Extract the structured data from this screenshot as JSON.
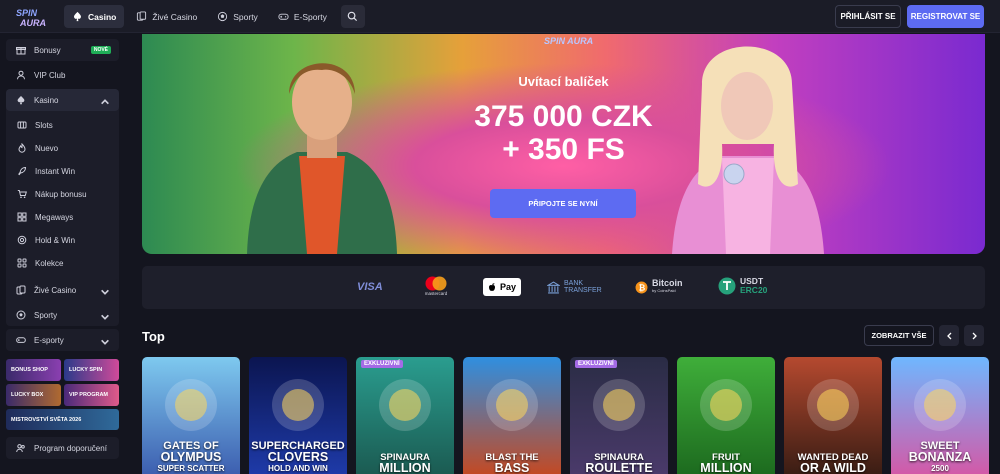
{
  "header": {
    "logo_text": "SPIN AURA",
    "nav": [
      {
        "label": "Casino",
        "icon": "spade-icon",
        "active": true
      },
      {
        "label": "Živé Casino",
        "icon": "cards-icon"
      },
      {
        "label": "Sporty",
        "icon": "ball-icon"
      },
      {
        "label": "E-Sporty",
        "icon": "gamepad-icon"
      }
    ],
    "login_label": "PŘIHLÁSIT SE",
    "register_label": "REGISTROVAT SE"
  },
  "sidebar": {
    "bonusy": {
      "label": "Bonusy",
      "badge": "NOVÉ"
    },
    "vip": {
      "label": "VIP Club"
    },
    "kasino": {
      "label": "Kasino"
    },
    "kasino_items": [
      {
        "label": "Slots",
        "icon": "slot-icon"
      },
      {
        "label": "Nuevo",
        "icon": "fire-icon"
      },
      {
        "label": "Instant Win",
        "icon": "rocket-icon"
      },
      {
        "label": "Nákup bonusu",
        "icon": "cart-icon"
      },
      {
        "label": "Megaways",
        "icon": "grid-icon"
      },
      {
        "label": "Hold & Win",
        "icon": "coin-icon"
      },
      {
        "label": "Kolekce",
        "icon": "collection-icon"
      }
    ],
    "live": {
      "label": "Živé Casino"
    },
    "sport": {
      "label": "Sporty"
    },
    "esport": {
      "label": "E-sporty"
    },
    "promos": [
      {
        "label": "BONUS SHOP"
      },
      {
        "label": "LUCKY SPIN"
      },
      {
        "label": "LUCKY BOX"
      },
      {
        "label": "VIP PROGRAM"
      },
      {
        "label": "MISTROVSTVÍ SVĚTA 2026"
      }
    ],
    "referral": {
      "label": "Program doporučení"
    }
  },
  "hero": {
    "logo_text": "SPIN AURA",
    "subtitle": "Uvítací balíček",
    "amount_line1": "375 000 CZK",
    "amount_line2": "+ 350 FS",
    "cta_label": "PŘIPOJTE SE NYNÍ"
  },
  "payments": {
    "visa": "VISA",
    "mastercard": "mastercard",
    "applepay": "Pay",
    "bank": [
      "BANK",
      "TRANSFER"
    ],
    "bitcoin": "Bitcoin",
    "bitcoin_sub": "by CoinsPaid",
    "usdt": [
      "USDT",
      "ERC20"
    ]
  },
  "top_section": {
    "title": "Top",
    "show_all_label": "ZOBRAZIT VŠE"
  },
  "games": [
    {
      "line1": "GATES OF",
      "line2": "OLYMPUS",
      "line3": "SUPER SCATTER",
      "exclusive": false,
      "color_top": "#7ec9ef",
      "color_bottom": "#3d5fb0"
    },
    {
      "line1": "SUPERCHARGED",
      "line2": "CLOVERS",
      "line3": "HOLD AND WIN",
      "exclusive": false,
      "color_top": "#0b1550",
      "color_bottom": "#1e3aa8"
    },
    {
      "line1": "SPINAURA",
      "line2": "MILLION",
      "line3": "",
      "exclusive": true,
      "exclusive_label": "EXKLUZIVNÍ",
      "color_top": "#2a9d8f",
      "color_bottom": "#1b5b52"
    },
    {
      "line1": "BLAST THE",
      "line2": "BASS",
      "line3": "",
      "exclusive": false,
      "color_top": "#2f8fe0",
      "color_bottom": "#c24a25"
    },
    {
      "line1": "SPINAURA",
      "line2": "ROULETTE",
      "line3": "",
      "exclusive": true,
      "exclusive_label": "EXKLUZIVNÍ",
      "color_top": "#2a2c45",
      "color_bottom": "#4a3a6a"
    },
    {
      "line1": "FRUIT",
      "line2": "MILLION",
      "line3": "",
      "exclusive": false,
      "color_top": "#3fae3a",
      "color_bottom": "#1d6b1f"
    },
    {
      "line1": "WANTED DEAD",
      "line2": "OR A WILD",
      "line3": "",
      "exclusive": false,
      "color_top": "#b5492f",
      "color_bottom": "#3a1d14"
    },
    {
      "line1": "SWEET",
      "line2": "BONANZA",
      "line3": "2500",
      "exclusive": false,
      "color_top": "#6fb7ff",
      "color_bottom": "#d25aa8"
    }
  ]
}
